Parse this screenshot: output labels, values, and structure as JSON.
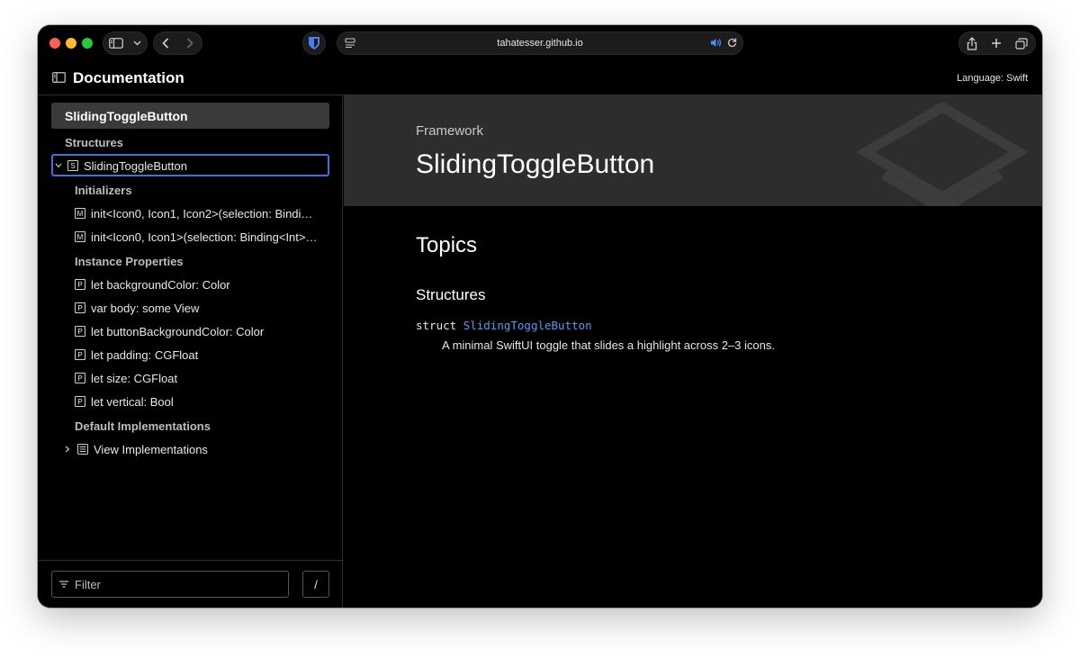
{
  "browser": {
    "url": "tahatesser.github.io",
    "icons": [
      "sidebar-toggle-icon",
      "chevron-down-icon",
      "back-icon",
      "forward-icon",
      "bitwarden-shield-icon",
      "page-menu-icon",
      "speaker-icon",
      "reload-icon",
      "share-icon",
      "plus-icon",
      "tabs-icon"
    ]
  },
  "header": {
    "title": "Documentation",
    "language": "Language: Swift"
  },
  "sidebar": {
    "root": "SlidingToggleButton",
    "structures_heading": "Structures",
    "structure": {
      "badge": "S",
      "label": "SlidingToggleButton"
    },
    "initializers_heading": "Initializers",
    "initializers": [
      {
        "badge": "M",
        "label": "init<Icon0, Icon1, Icon2>(selection: Bindi…"
      },
      {
        "badge": "M",
        "label": "init<Icon0, Icon1>(selection: Binding<Int>…"
      }
    ],
    "properties_heading": "Instance Properties",
    "properties": [
      {
        "badge": "P",
        "label": "let backgroundColor: Color"
      },
      {
        "badge": "P",
        "label": "var body: some View"
      },
      {
        "badge": "P",
        "label": "let buttonBackgroundColor: Color"
      },
      {
        "badge": "P",
        "label": "let padding: CGFloat"
      },
      {
        "badge": "P",
        "label": "let size: CGFloat"
      },
      {
        "badge": "P",
        "label": "let vertical: Bool"
      }
    ],
    "defaults_heading": "Default Implementations",
    "default_item": "View Implementations",
    "filter_placeholder": "Filter",
    "filter_shortcut": "/"
  },
  "main": {
    "eyebrow": "Framework",
    "title": "SlidingToggleButton",
    "topics_heading": "Topics",
    "structures_heading": "Structures",
    "decl_keyword": "struct",
    "decl_name": "SlidingToggleButton",
    "abstract": "A minimal SwiftUI toggle that slides a highlight across 2–3 icons."
  },
  "colors": {
    "accent": "#3a74d8",
    "link": "#5b9cf0",
    "hero_bg": "#2d2d2d",
    "selected_bg": "#3a3a3c"
  }
}
